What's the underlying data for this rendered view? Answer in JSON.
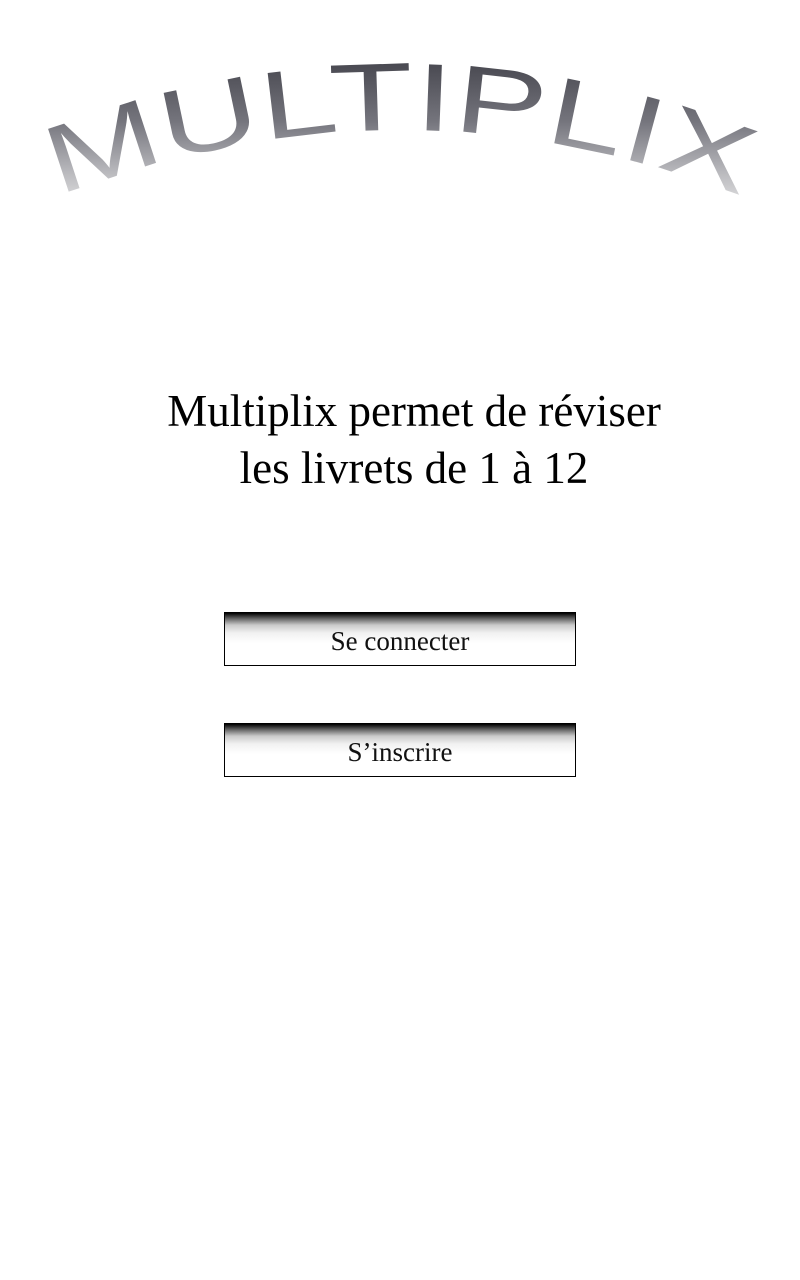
{
  "app": {
    "logo_text": "MULTIPLIX"
  },
  "tagline": {
    "line1": "Multiplix permet de réviser",
    "line2": "les livrets de 1 à 12"
  },
  "buttons": {
    "login_label": "Se connecter",
    "register_label": "S’inscrire"
  },
  "colors": {
    "background": "#ffffff",
    "text": "#000000",
    "logo_gradient_top": "#3a3a42",
    "logo_gradient_bottom": "#ececec",
    "button_border": "#000000"
  }
}
